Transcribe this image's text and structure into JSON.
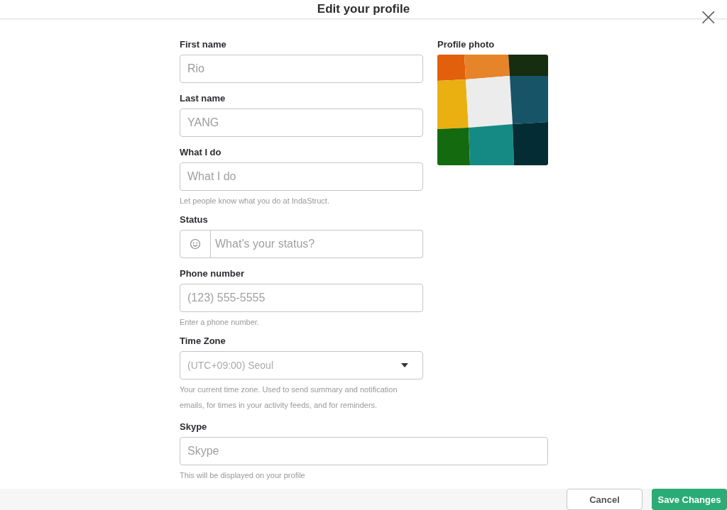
{
  "header": {
    "title": "Edit your profile",
    "close": "×"
  },
  "fields": [
    {
      "kind": "text",
      "label": "First name",
      "value": "Rio"
    },
    {
      "kind": "text",
      "label": "Last name",
      "value": "YANG"
    },
    {
      "kind": "text",
      "label": "What I do",
      "placeholder": "What I do",
      "hint": "Let people know what you do at IndaStruct."
    },
    {
      "kind": "status",
      "label": "Status",
      "placeholder": "What’s your status?"
    },
    {
      "kind": "text",
      "label": "Phone number",
      "placeholder": "(123) 555-5555",
      "hint": "Enter a phone number."
    },
    {
      "kind": "select",
      "label": "Time Zone",
      "value": "(UTC+09:00) Seoul",
      "hint": "Your current time zone. Used to send summary and notification emails, for times in your activity feeds, and for reminders."
    }
  ],
  "profile_photo": {
    "label": "Profile photo",
    "kind": "picture"
  },
  "wide_fields": [
    {
      "kind": "text",
      "label": "Skype",
      "placeholder": "Skype",
      "hint": "This will be displayed on your profile"
    }
  ],
  "footer": {
    "buttons": [
      {
        "label": "Cancel",
        "kind": "secondary"
      },
      {
        "label": "Save Changes",
        "kind": "primary"
      }
    ]
  }
}
